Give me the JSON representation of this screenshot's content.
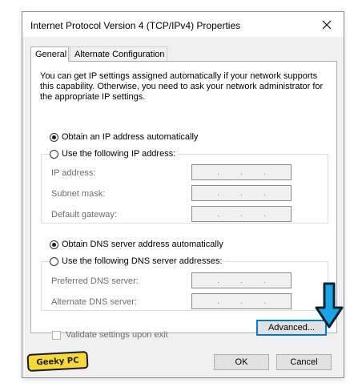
{
  "window": {
    "title": "Internet Protocol Version 4 (TCP/IPv4) Properties",
    "close_icon": "close-icon"
  },
  "tabs": [
    {
      "label": "General",
      "selected": true
    },
    {
      "label": "Alternate Configuration",
      "selected": false
    }
  ],
  "intro_text": "You can get IP settings assigned automatically if your network supports this capability. Otherwise, you need to ask your network administrator for the appropriate IP settings.",
  "ip_settings": {
    "auto_label": "Obtain an IP address automatically",
    "manual_label": "Use the following IP address:",
    "selected": "auto",
    "fields": [
      {
        "label": "IP address:",
        "value": ". . ."
      },
      {
        "label": "Subnet mask:",
        "value": ". . ."
      },
      {
        "label": "Default gateway:",
        "value": ". . ."
      }
    ]
  },
  "dns_settings": {
    "auto_label": "Obtain DNS server address automatically",
    "manual_label": "Use the following DNS server addresses:",
    "selected": "auto",
    "fields": [
      {
        "label": "Preferred DNS server:",
        "value": ". . ."
      },
      {
        "label": "Alternate DNS server:",
        "value": ". . ."
      }
    ]
  },
  "validate_label": "Validate settings upon exit",
  "buttons": {
    "advanced": "Advanced...",
    "ok": "OK",
    "cancel": "Cancel"
  },
  "watermark": "Geeky PC",
  "colors": {
    "accent": "#0078d7",
    "arrow": "#1aa6e6",
    "badge": "#f5d83a"
  }
}
